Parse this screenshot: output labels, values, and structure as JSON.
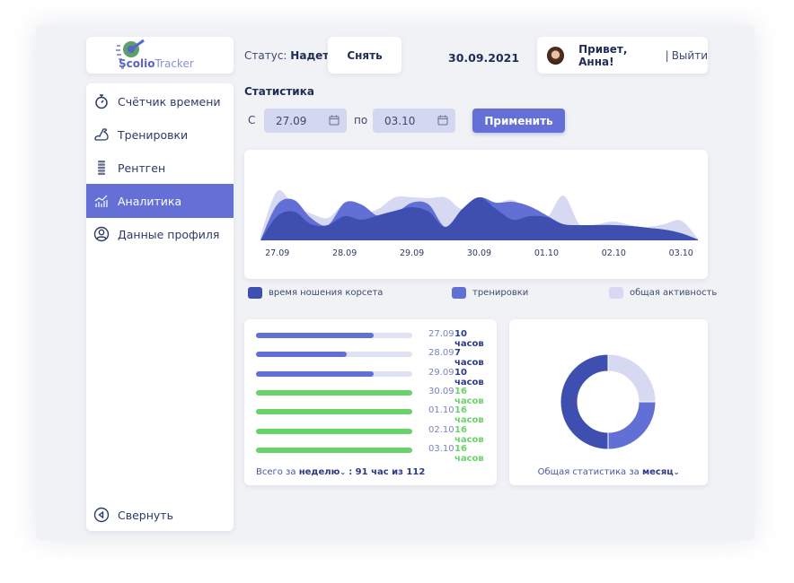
{
  "logo": {
    "brand_bold": "Scolio",
    "brand_light": "Tracker"
  },
  "sidebar": {
    "items": [
      {
        "label": "Счётчик времени",
        "icon": "stopwatch-icon"
      },
      {
        "label": "Тренировки",
        "icon": "muscle-arm-icon"
      },
      {
        "label": "Рентген",
        "icon": "spine-icon"
      },
      {
        "label": "Аналитика",
        "icon": "analytics-chart-icon",
        "active": true
      },
      {
        "label": "Данные профиля",
        "icon": "user-circle-icon"
      }
    ],
    "collapse_label": "Свернуть"
  },
  "header": {
    "status_label": "Статус:",
    "status_value": "Надет",
    "take_off_label": "Снять",
    "date": "30.09.2021",
    "greeting": "Привет, Анна!",
    "separator": "|",
    "logout_label": "Выйти"
  },
  "stats": {
    "title": "Статистика",
    "from_label": "С",
    "from_value": "27.09",
    "to_label": "по",
    "to_value": "03.10",
    "apply_label": "Применить"
  },
  "colors": {
    "accent": "#6470d6",
    "dark": "#3f4fb0",
    "mid": "#6270d6",
    "light": "#d6d9f1",
    "green": "#68d36a"
  },
  "chart_data": {
    "type": "area",
    "x_tick_labels": [
      "27.09",
      "28.09",
      "29.09",
      "30.09",
      "01.10",
      "02.10",
      "03.10"
    ],
    "x": [
      "26.09 18:00",
      "27.09 00:00",
      "27.09 06:00",
      "27.09 12:00",
      "27.09 18:00",
      "28.09 00:00",
      "28.09 06:00",
      "28.09 12:00",
      "28.09 18:00",
      "29.09 00:00",
      "29.09 06:00",
      "29.09 12:00",
      "29.09 18:00",
      "30.09 00:00",
      "30.09 06:00",
      "30.09 12:00",
      "30.09 18:00",
      "01.10 00:00",
      "01.10 06:00",
      "01.10 12:00",
      "01.10 18:00",
      "02.10 00:00",
      "02.10 06:00",
      "02.10 12:00",
      "02.10 18:00",
      "03.10 00:00",
      "03.10 06:00"
    ],
    "ylim": [
      0,
      60
    ],
    "grid": false,
    "legend_position": "bottom",
    "series": [
      {
        "name": "общая активность",
        "color": "#d6d9f1",
        "values": [
          5,
          55,
          38,
          30,
          25,
          40,
          30,
          35,
          48,
          48,
          47,
          48,
          35,
          48,
          42,
          45,
          32,
          25,
          50,
          17,
          18,
          21,
          17,
          15,
          18,
          22,
          2
        ]
      },
      {
        "name": "тренировки",
        "color": "#6270d6",
        "values": [
          0,
          40,
          45,
          25,
          17,
          42,
          40,
          27,
          30,
          42,
          40,
          15,
          35,
          48,
          42,
          43,
          38,
          28,
          18,
          17,
          17,
          17,
          16,
          14,
          12,
          8,
          1
        ]
      },
      {
        "name": "время ношения корсета",
        "color": "#3f4fb0",
        "values": [
          0,
          27,
          32,
          18,
          17,
          27,
          23,
          28,
          33,
          37,
          32,
          15,
          35,
          48,
          35,
          23,
          27,
          26,
          18,
          17,
          17,
          17,
          16,
          14,
          12,
          8,
          1
        ]
      }
    ],
    "legend": [
      "время ношения корсета",
      "тренировки",
      "общая активность"
    ]
  },
  "daily": {
    "rows": [
      {
        "date": "27.09",
        "value": "10 часов",
        "fill": 0.75,
        "status": "partial"
      },
      {
        "date": "28.09",
        "value": "7 часов",
        "fill": 0.58,
        "status": "partial"
      },
      {
        "date": "29.09",
        "value": "10 часов",
        "fill": 0.75,
        "status": "partial"
      },
      {
        "date": "30.09",
        "value": "16 часов",
        "fill": 1,
        "status": "full"
      },
      {
        "date": "01.10",
        "value": "16 часов",
        "fill": 1,
        "status": "full"
      },
      {
        "date": "02.10",
        "value": "16 часов",
        "fill": 1,
        "status": "full"
      },
      {
        "date": "03.10",
        "value": "16 часов",
        "fill": 1,
        "status": "full"
      }
    ],
    "total_prefix": "Всего за",
    "period": "неделю",
    "total_value": ": 91 час из 112"
  },
  "donut": {
    "caption_prefix": "Общая статистика за",
    "period": "месяц",
    "segments": [
      {
        "share": 25,
        "color": "#d6d9f1"
      },
      {
        "share": 25,
        "color": "#6270d6"
      },
      {
        "share": 50,
        "color": "#3f4fb0"
      }
    ]
  }
}
